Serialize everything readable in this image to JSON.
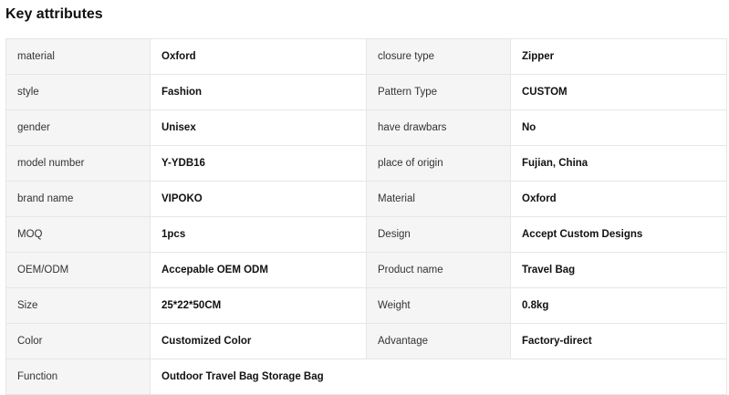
{
  "title": "Key attributes",
  "rows": [
    [
      {
        "k": "material",
        "v": "Oxford"
      },
      {
        "k": "closure type",
        "v": "Zipper"
      }
    ],
    [
      {
        "k": "style",
        "v": "Fashion"
      },
      {
        "k": "Pattern Type",
        "v": "CUSTOM"
      }
    ],
    [
      {
        "k": "gender",
        "v": "Unisex"
      },
      {
        "k": "have drawbars",
        "v": "No"
      }
    ],
    [
      {
        "k": "model number",
        "v": "Y-YDB16"
      },
      {
        "k": "place of origin",
        "v": "Fujian, China"
      }
    ],
    [
      {
        "k": "brand name",
        "v": "VIPOKO"
      },
      {
        "k": "Material",
        "v": "Oxford"
      }
    ],
    [
      {
        "k": "MOQ",
        "v": "1pcs"
      },
      {
        "k": "Design",
        "v": "Accept Custom Designs"
      }
    ],
    [
      {
        "k": "OEM/ODM",
        "v": "Accepable OEM ODM"
      },
      {
        "k": "Product name",
        "v": "Travel Bag"
      }
    ],
    [
      {
        "k": "Size",
        "v": "25*22*50CM"
      },
      {
        "k": "Weight",
        "v": "0.8kg"
      }
    ],
    [
      {
        "k": "Color",
        "v": "Customized Color"
      },
      {
        "k": "Advantage",
        "v": "Factory-direct"
      }
    ],
    [
      {
        "k": "Function",
        "v": "Outdoor Travel Bag Storage Bag"
      }
    ]
  ]
}
